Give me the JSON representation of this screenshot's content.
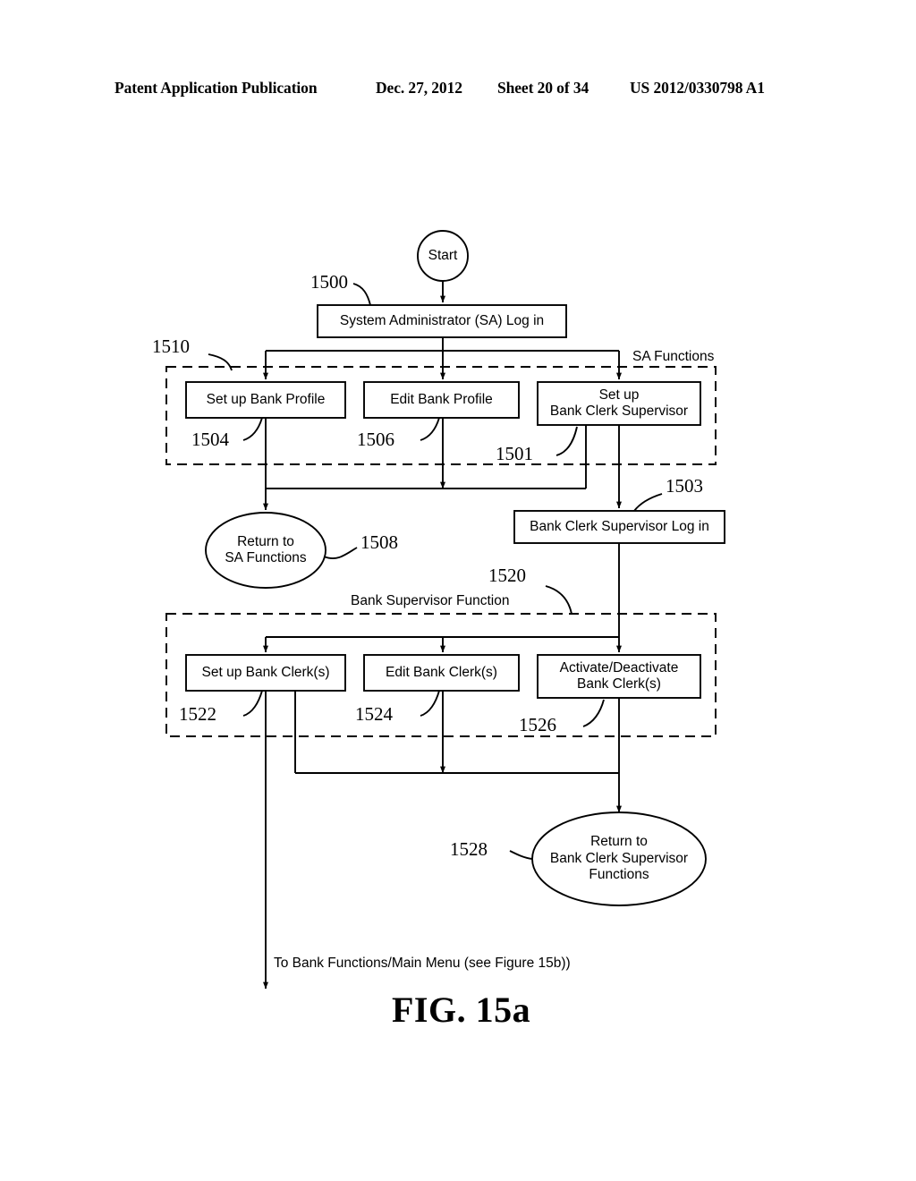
{
  "header": {
    "publication": "Patent Application Publication",
    "date": "Dec. 27, 2012",
    "sheet": "Sheet 20 of 34",
    "patent_number": "US 2012/0330798 A1"
  },
  "figure": {
    "caption": "FIG. 15a"
  },
  "nodes": {
    "start": "Start",
    "sa_login": "System Administrator (SA) Log in",
    "setup_bank_profile": "Set up Bank Profile",
    "edit_bank_profile": "Edit Bank Profile",
    "setup_bank_clerk_supervisor": "Set up\nBank Clerk Supervisor",
    "return_sa_functions": "Return to\nSA Functions",
    "bank_clerk_supervisor_login": "Bank Clerk Supervisor Log in",
    "setup_bank_clerks": "Set up Bank Clerk(s)",
    "edit_bank_clerks": "Edit Bank Clerk(s)",
    "activate_deactivate_bank_clerks": "Activate/Deactivate\nBank Clerk(s)",
    "return_bank_clerk_supervisor_functions": "Return to\nBank Clerk Supervisor\nFunctions"
  },
  "groups": {
    "sa_functions_label": "SA Functions",
    "bank_supervisor_function_label": "Bank Supervisor Function"
  },
  "annotations": {
    "exit_note": "To Bank Functions/Main Menu (see Figure 15b))"
  },
  "reference_numerals": {
    "n1500": "1500",
    "n1510": "1510",
    "n1504": "1504",
    "n1506": "1506",
    "n1501": "1501",
    "n1503": "1503",
    "n1508": "1508",
    "n1520": "1520",
    "n1522": "1522",
    "n1524": "1524",
    "n1526": "1526",
    "n1528": "1528"
  },
  "style": {
    "ink": "#000000",
    "paper": "#ffffff"
  }
}
